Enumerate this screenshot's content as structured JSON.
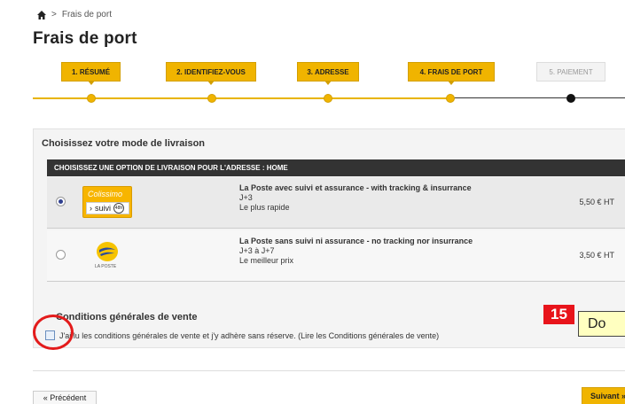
{
  "breadcrumb": {
    "separator": ">",
    "current": "Frais de port"
  },
  "page": {
    "title": "Frais de port"
  },
  "steps": [
    {
      "label": "1. Résumé",
      "state": "done"
    },
    {
      "label": "2. Identifiez-vous",
      "state": "done"
    },
    {
      "label": "3. Adresse",
      "state": "done"
    },
    {
      "label": "4. Frais de port",
      "state": "done"
    },
    {
      "label": "5. Paiement",
      "state": "todo"
    }
  ],
  "delivery": {
    "title": "Choisissez votre mode de livraison",
    "table_header": "Choisissez une option de livraison pour l'adresse : Home",
    "options": [
      {
        "selected": true,
        "logo": "colissimo-logo",
        "logo_top": "Colissimo",
        "logo_bottom": "suivi",
        "logo_badge": "48h",
        "name": "La Poste avec suivi et assurance - with tracking & insurrance",
        "delay": "J+3",
        "note": "Le plus rapide",
        "price": "5,50 € HT"
      },
      {
        "selected": false,
        "logo": "laposte-logo",
        "logo_caption": "LA POSTE",
        "name": "La Poste sans suivi ni assurance - no tracking nor insurrance",
        "delay": "J+3 à J+7",
        "note": "Le meilleur prix",
        "price": "3,50 € HT"
      }
    ]
  },
  "cgv": {
    "title": "Conditions générales de vente",
    "checkbox_label": "J'ai lu les conditions générales de vente et j'y adhère sans réserve. (Lire les Conditions générales de vente)",
    "checked": false
  },
  "annotation": {
    "number": "15",
    "text": "Do"
  },
  "nav": {
    "prev_label": "« Précédent",
    "next_label": "Suivant »"
  },
  "colors": {
    "accent": "#f0b400",
    "dark": "#333333",
    "annotation_red": "#e8141b"
  }
}
